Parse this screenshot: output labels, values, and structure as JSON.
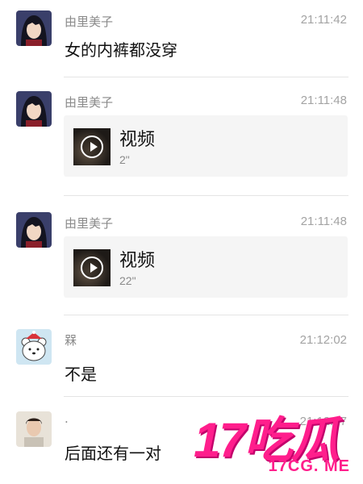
{
  "messages": [
    {
      "name": "由里美子",
      "time": "21:11:42",
      "text": "女的内裤都没穿",
      "avatar": "anime-girl-avatar"
    },
    {
      "name": "由里美子",
      "time": "21:11:48",
      "video_title": "视频",
      "video_duration": "2\"",
      "avatar": "anime-girl-avatar"
    },
    {
      "name": "由里美子",
      "time": "21:11:48",
      "video_title": "视频",
      "video_duration": "22\"",
      "avatar": "anime-girl-avatar"
    },
    {
      "name": "槑",
      "time": "21:12:02",
      "text": "不是",
      "avatar": "cartoon-bear-avatar"
    },
    {
      "name": ".",
      "time": "21:12:07",
      "text": "后面还有一对",
      "avatar": "photo-avatar"
    }
  ],
  "watermark": {
    "big": "17吃瓜",
    "small": "17CG. ME"
  },
  "colors": {
    "watermark": "#ff1e8c",
    "timestamp": "#a3a3a3",
    "card_bg": "#f5f5f5"
  }
}
